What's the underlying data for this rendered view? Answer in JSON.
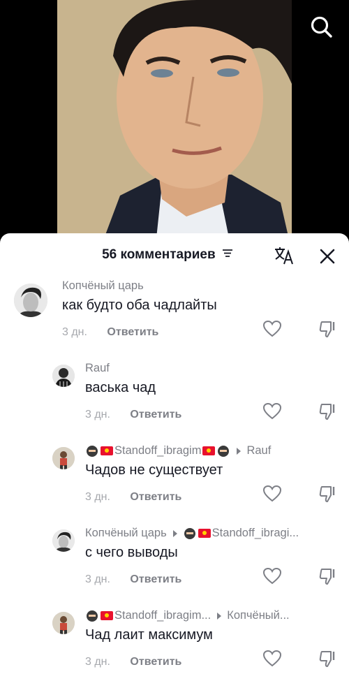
{
  "sheet": {
    "title": "56 комментариев"
  },
  "comments": [
    {
      "author": "Копчёный царь",
      "text": "как будто оба чадлайты",
      "time": "3 дн.",
      "reply": "Ответить"
    },
    {
      "author": "Rauf",
      "text": "васька чад",
      "time": "3 дн.",
      "reply": "Ответить"
    },
    {
      "author": "Standoff_ibragim",
      "reply_to": "Rauf",
      "text": "Чадов не существует",
      "time": "3 дн.",
      "reply": "Ответить"
    },
    {
      "author": "Копчёный царь",
      "reply_to": "Standoff_ibragi...",
      "text": "с чего выводы",
      "time": "3 дн.",
      "reply": "Ответить"
    },
    {
      "author": "Standoff_ibragim...",
      "reply_to": "Копчёный...",
      "text": "Чад лаит максимум",
      "time": "3 дн.",
      "reply": "Ответить"
    }
  ],
  "colors": {
    "text": "#161823",
    "secondary": "#7d7f86",
    "muted": "#a6a8ad",
    "sheet_bg": "#ffffff"
  }
}
